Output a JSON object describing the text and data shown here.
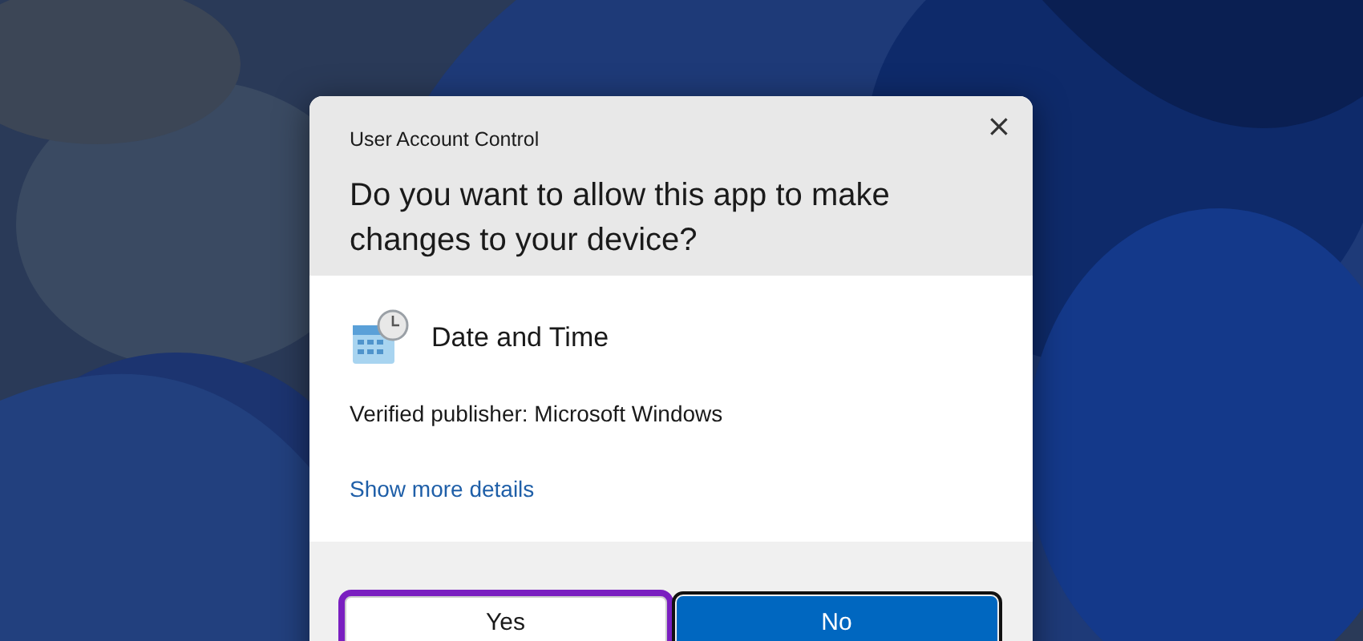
{
  "dialog": {
    "title": "User Account Control",
    "close": "×",
    "question": "Do you want to allow this app to make changes to your device?",
    "app_name": "Date and Time",
    "publisher": "Verified publisher: Microsoft Windows",
    "details_link": "Show more details",
    "buttons": [
      {
        "label": "Yes",
        "kind": "secondary",
        "highlighted": true
      },
      {
        "label": "No",
        "kind": "primary",
        "highlighted": false
      }
    ]
  }
}
